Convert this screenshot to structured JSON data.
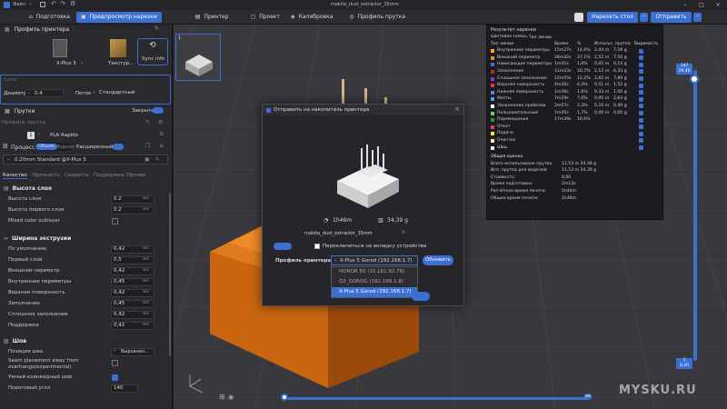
{
  "app": {
    "menu_label": "Файл",
    "file_title": "makita_dust_extractor_35mm"
  },
  "tabs": [
    {
      "label": "Подготовка",
      "icon": "home-icon"
    },
    {
      "label": "Предпросмотр нарезки",
      "icon": "preview-icon"
    },
    {
      "label": "Принтер",
      "icon": "printer-icon"
    },
    {
      "label": "Проект",
      "icon": "project-icon"
    },
    {
      "label": "Калибровка",
      "icon": "calibration-icon"
    },
    {
      "label": "Профиль прутка",
      "icon": "filament-icon"
    }
  ],
  "actions": {
    "slice_label": "Нарезать стол",
    "send_label": "Отправить"
  },
  "left": {
    "printer_profile_title": "Профиль принтера",
    "printer_name": "X-Plus 5",
    "texture_label": "Текстур...",
    "sync_label": "Sync info",
    "diameter_label": "Диаметр",
    "diameter_value": "0.4",
    "flow_label": "Поток",
    "flow_value": "Стандартный",
    "nozzle_label": "Сопло",
    "filaments_title": "Прутки",
    "close_label": "Закрыть",
    "filament_profile_label": "Профиль прутка",
    "filament_slot": "1",
    "filament_name": "PLA Rapido",
    "process_title": "Процесс",
    "process_common": "Общие",
    "process_models": "Модели",
    "process_advanced": "Расширенный",
    "process_profile": "0.20mm Standard @X-Plus 5",
    "subtabs": [
      "Качество",
      "Прочность",
      "Скорость",
      "Поддержка",
      "Прочее"
    ],
    "layer_height_group": "Высота слоя",
    "layer_height_label": "Высота слоя",
    "layer_height_value": "0.2",
    "first_layer_label": "Высота первого слоя",
    "first_layer_value": "0.2",
    "mixed_color_label": "Mixed color sublayer",
    "unit_mm": "мм",
    "width_group": "Ширина экструзии",
    "widths": [
      {
        "label": "По умолчанию",
        "value": "0,42"
      },
      {
        "label": "Первый слой",
        "value": "0,5"
      },
      {
        "label": "Внешний периметр",
        "value": "0,42"
      },
      {
        "label": "Внутренние периметры",
        "value": "0,45"
      },
      {
        "label": "Верхняя поверхность",
        "value": "0,42"
      },
      {
        "label": "Заполнение",
        "value": "0,45"
      },
      {
        "label": "Сплошное заполнение",
        "value": "0,42"
      },
      {
        "label": "Поддержка",
        "value": "0,42"
      }
    ],
    "seam_group": "Шов",
    "seam_position_label": "Позиция шва",
    "seam_position_value": "Выровнен...",
    "seam_away_label": "Seam placement away from overhangs(experimental)",
    "smart_seam_label": "Умный коинкидный шов",
    "threshold_label": "Пороговый угол",
    "threshold_value": "140"
  },
  "results": {
    "title": "Результат нарезки",
    "color_scheme_label": "Цветовая схема",
    "color_scheme_value": "Тип линии",
    "col_type": "Тип линии",
    "col_time": "Время",
    "col_pct": "%",
    "col_usage": "Использ. прутка",
    "col_vis": "Видимость",
    "lines": [
      {
        "name": "Внутренние периметры",
        "time": "15m27s",
        "pct": "14,6%",
        "m": "2,44 m",
        "g": "7,28 g",
        "color": "#f5a623"
      },
      {
        "name": "Внешний периметр",
        "time": "28m42s",
        "pct": "27,1%",
        "m": "2,52 m",
        "g": "7,50 g",
        "color": "#e8893a"
      },
      {
        "name": "Нависающие периметры",
        "time": "1m41s",
        "pct": "1,6%",
        "m": "0,05 m",
        "g": "0,14 g",
        "color": "#3f6bd6"
      },
      {
        "name": "Заполнение",
        "time": "11m23s",
        "pct": "10,7%",
        "m": "2,12 m",
        "g": "6,33 g",
        "color": "#a83232"
      },
      {
        "name": "Сплошное заполнение",
        "time": "12m55s",
        "pct": "12,2%",
        "m": "2,65 m",
        "g": "7,89 g",
        "color": "#9a2fd1"
      },
      {
        "name": "Верхняя поверхность",
        "time": "4m30s",
        "pct": "4,3%",
        "m": "0,51 m",
        "g": "1,52 g",
        "color": "#e03a3a"
      },
      {
        "name": "Нижняя поверхность",
        "time": "1m39s",
        "pct": "1,6%",
        "m": "0,33 m",
        "g": "1,00 g",
        "color": "#6b79d8"
      },
      {
        "name": "Мосты",
        "time": "7m29s",
        "pct": "7,0%",
        "m": "0,95 m",
        "g": "2,83 g",
        "color": "#4a9fd6"
      },
      {
        "name": "Заполнение пробелов",
        "time": "2m07s",
        "pct": "2,3%",
        "m": "0,16 m",
        "g": "0,49 g",
        "color": "#ffffff"
      },
      {
        "name": "Пользовательский",
        "time": "1m45s",
        "pct": "1,7%",
        "m": "0,00 m",
        "g": "0,00 g",
        "color": "#5fd15f"
      },
      {
        "name": "Перемещения",
        "time": "17m39s",
        "pct": "16,6%",
        "m": "",
        "g": "",
        "color": "#3a8f3a"
      },
      {
        "name": "Откат",
        "time": "",
        "pct": "",
        "m": "",
        "g": "",
        "color": "#d6406a"
      },
      {
        "name": "Подача",
        "time": "",
        "pct": "",
        "m": "",
        "g": "",
        "color": "#f0e23a"
      },
      {
        "name": "Очистка",
        "time": "",
        "pct": "",
        "m": "",
        "g": "",
        "color": "#f0f0a0"
      },
      {
        "name": "Швы",
        "time": "",
        "pct": "",
        "m": "",
        "g": "",
        "color": "#e8e8e8"
      }
    ],
    "summary_title": "Общая оценка",
    "summary": [
      {
        "label": "Всего использовано прутка",
        "value": "11,53 m     34,39 g"
      },
      {
        "label": "Исп. прутка для моделей",
        "value": "11,53 m     34,39 g"
      },
      {
        "label": "Стоимость:",
        "value": "0,00"
      },
      {
        "label": "Время подготовки:",
        "value": "2m12s"
      },
      {
        "label": "Расчётное время печати:",
        "value": "1h44m"
      },
      {
        "label": "Общее время печати:",
        "value": "1h46m"
      }
    ]
  },
  "dialog": {
    "title": "Отправить на накопитель принтера",
    "time": "1h46m",
    "weight": "34,39 g",
    "filename": "makita_dust_extractor_35mm",
    "switch_label": "Переключиться на вкладку устройства",
    "printer_profile_label": "Профиль принтера",
    "selected_printer": "X-Plus 5 Gorod (192.168.1.7)",
    "refresh_label": "Обновить",
    "send_label": "Отправить",
    "options": [
      "HONOR 50 (10.161.92.76)",
      "Q2_GOROG (192.168.1.8)",
      "X-Plus 5 Gorod (192.168.1.7)"
    ]
  },
  "viewport": {
    "layer_top": "147",
    "layer_top_sub": "29.40",
    "layer_bottom": "1",
    "layer_bottom_sub": "0.20",
    "progress_right": "49",
    "watermark": "MYSKU.RU"
  }
}
